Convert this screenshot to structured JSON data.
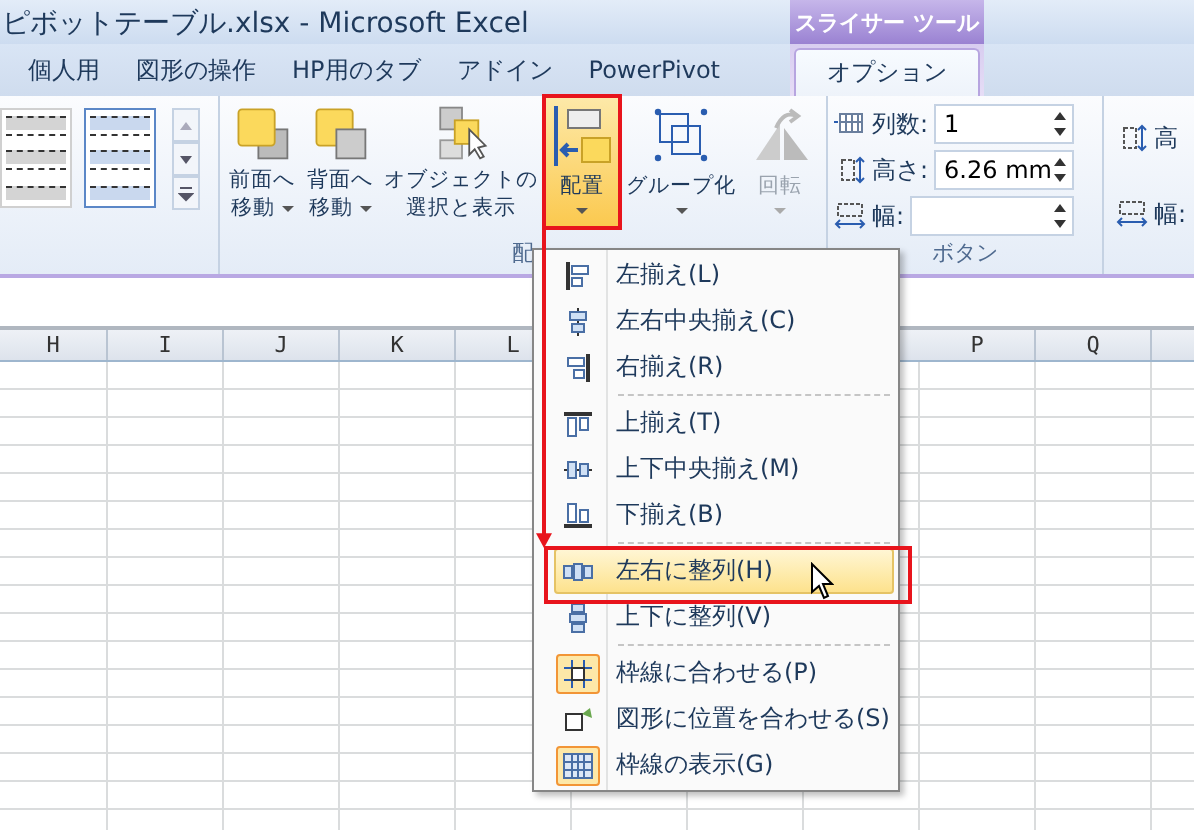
{
  "window": {
    "title": "ピボットテーブル.xlsx - Microsoft Excel"
  },
  "tabs": [
    {
      "label": "個人用",
      "selected": false
    },
    {
      "label": "図形の操作",
      "selected": false
    },
    {
      "label": "HP用のタブ",
      "selected": false
    },
    {
      "label": "アドイン",
      "selected": false
    },
    {
      "label": "PowerPivot",
      "selected": false
    }
  ],
  "contextual_tabs": {
    "header": "スライサー ツール",
    "tabs": [
      {
        "label": "オプション",
        "selected": true
      }
    ]
  },
  "ribbon": {
    "gallery": {
      "styles": [
        {
          "selected": false
        },
        {
          "selected": true
        }
      ]
    },
    "arrange_group": {
      "label": "配",
      "buttons": [
        {
          "lines": [
            "前面へ",
            "移動"
          ],
          "dropdown": true,
          "pressed": false,
          "disabled": false
        },
        {
          "lines": [
            "背面へ",
            "移動"
          ],
          "dropdown": true,
          "pressed": false,
          "disabled": false
        },
        {
          "lines": [
            "オブジェクトの",
            "選択と表示"
          ],
          "dropdown": false,
          "pressed": false,
          "disabled": false
        },
        {
          "lines": [
            "配置"
          ],
          "dropdown": true,
          "pressed": true,
          "disabled": false
        },
        {
          "lines": [
            "グループ化"
          ],
          "dropdown": true,
          "pressed": false,
          "disabled": false
        },
        {
          "lines": [
            "回転"
          ],
          "dropdown": true,
          "pressed": false,
          "disabled": true
        }
      ]
    },
    "size_group": {
      "label": "ボタン",
      "fields": [
        {
          "label": "列数:",
          "value": "1"
        },
        {
          "label": "高さ:",
          "value": "6.26 mm"
        },
        {
          "label": "幅:"
        }
      ]
    },
    "size_group_2": {
      "fields": [
        {
          "label": "高"
        },
        {
          "label": "幅:"
        }
      ]
    }
  },
  "sheet": {
    "columns_left": [
      "H",
      "I",
      "J",
      "K",
      "L"
    ],
    "columns_right": [
      "P",
      "Q"
    ]
  },
  "menu": {
    "items": [
      {
        "kind": "item",
        "label": "左揃え(L)",
        "highlighted": false,
        "checked": false
      },
      {
        "kind": "item",
        "label": "左右中央揃え(C)",
        "highlighted": false,
        "checked": false
      },
      {
        "kind": "item",
        "label": "右揃え(R)",
        "highlighted": false,
        "checked": false
      },
      {
        "kind": "separator"
      },
      {
        "kind": "item",
        "label": "上揃え(T)",
        "highlighted": false,
        "checked": false
      },
      {
        "kind": "item",
        "label": "上下中央揃え(M)",
        "highlighted": false,
        "checked": false
      },
      {
        "kind": "item",
        "label": "下揃え(B)",
        "highlighted": false,
        "checked": false
      },
      {
        "kind": "separator"
      },
      {
        "kind": "item",
        "label": "左右に整列(H)",
        "highlighted": true,
        "checked": false
      },
      {
        "kind": "item",
        "label": "上下に整列(V)",
        "highlighted": false,
        "checked": false
      },
      {
        "kind": "separator"
      },
      {
        "kind": "item",
        "label": "枠線に合わせる(P)",
        "highlighted": false,
        "checked": true
      },
      {
        "kind": "item",
        "label": "図形に位置を合わせる(S)",
        "highlighted": false,
        "checked": false
      },
      {
        "kind": "item",
        "label": "枠線の表示(G)",
        "highlighted": false,
        "checked": true
      }
    ]
  }
}
